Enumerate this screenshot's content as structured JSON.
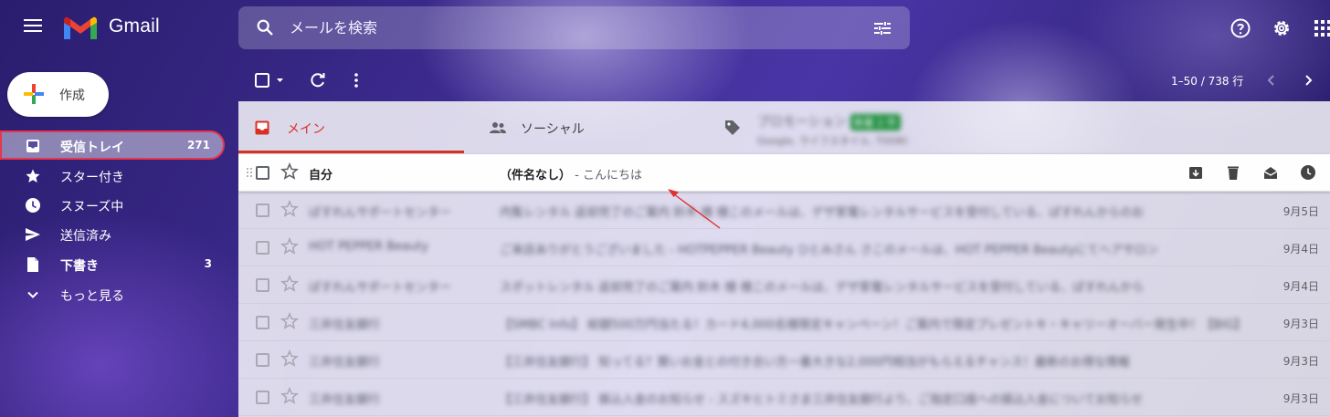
{
  "app": {
    "logo_text": "Gmail",
    "brand_colors": {
      "red": "#ea4335",
      "blue": "#4285f4",
      "green": "#34a853",
      "yellow": "#fbbc04"
    }
  },
  "search": {
    "placeholder": "メールを検索"
  },
  "compose": {
    "label": "作成"
  },
  "sidebar": {
    "items": [
      {
        "label": "受信トレイ",
        "count": "271",
        "icon": "inbox-icon"
      },
      {
        "label": "スター付き",
        "count": "",
        "icon": "star-icon"
      },
      {
        "label": "スヌーズ中",
        "count": "",
        "icon": "clock-icon"
      },
      {
        "label": "送信済み",
        "count": "",
        "icon": "send-icon"
      },
      {
        "label": "下書き",
        "count": "3",
        "icon": "draft-icon"
      },
      {
        "label": "もっと見る",
        "count": "",
        "icon": "chevron-down-icon"
      }
    ]
  },
  "toolbar": {
    "pager": "1–50 / 738 行"
  },
  "tabs": [
    {
      "label": "メイン",
      "icon": "inbox-icon"
    },
    {
      "label": "ソーシャル",
      "icon": "people-icon"
    },
    {
      "label": "プロモーション",
      "badge": "新着 2 件",
      "sub": "Google, ライフスタイル, TOOKI",
      "icon": "tag-icon"
    }
  ],
  "emails": [
    {
      "sender": "自分",
      "subject": "（件名なし）",
      "snippet": " - こんにちは",
      "date": ""
    },
    {
      "sender": "ぱすれんサポートセンター",
      "subject": "内覧レンタル 返却完了のご案内 鈴木 様 様このメールは、デザ家電レンタルサービスを受付している、ぱすれんからのお",
      "snippet": "",
      "date": "9月5日"
    },
    {
      "sender": "HOT PEPPER Beauty",
      "subject": "ご来店ありがとうございました - HOTPEPPER Beauty ひとみさん さこのメールは、HOT PEPPER Beautyにてヘアサロン",
      "snippet": "",
      "date": "9月4日"
    },
    {
      "sender": "ぱすれんサポートセンター",
      "subject": "スポットレンタル 返却完了のご案内 鈴木 様 様このメールは、デザ家電レンタルサービスを受付している、ぱすれんから",
      "snippet": "",
      "date": "9月4日"
    },
    {
      "sender": "三井住友銀行",
      "subject": "【SMBC Info】 総額500万円当たる！カード4,000名様限定キャンペーン！ご案内で限定プレゼントキ・キャリーオーバー発生中！【BIG】",
      "snippet": "",
      "date": "9月3日"
    },
    {
      "sender": "三井住友銀行",
      "subject": "【三井住友銀行】 知ってる？賢いお金との付き合い方一番大きな2,000円相当がもらえるチャンス！最新のお得な情報",
      "snippet": "",
      "date": "9月3日"
    },
    {
      "sender": "三井住友銀行",
      "subject": "【三井住友銀行】 振込入金のお知らせ - スズキヒトミさま三井住友銀行より、ご指定口座への振込入金についてお知らせ",
      "snippet": "",
      "date": "9月3日"
    }
  ]
}
